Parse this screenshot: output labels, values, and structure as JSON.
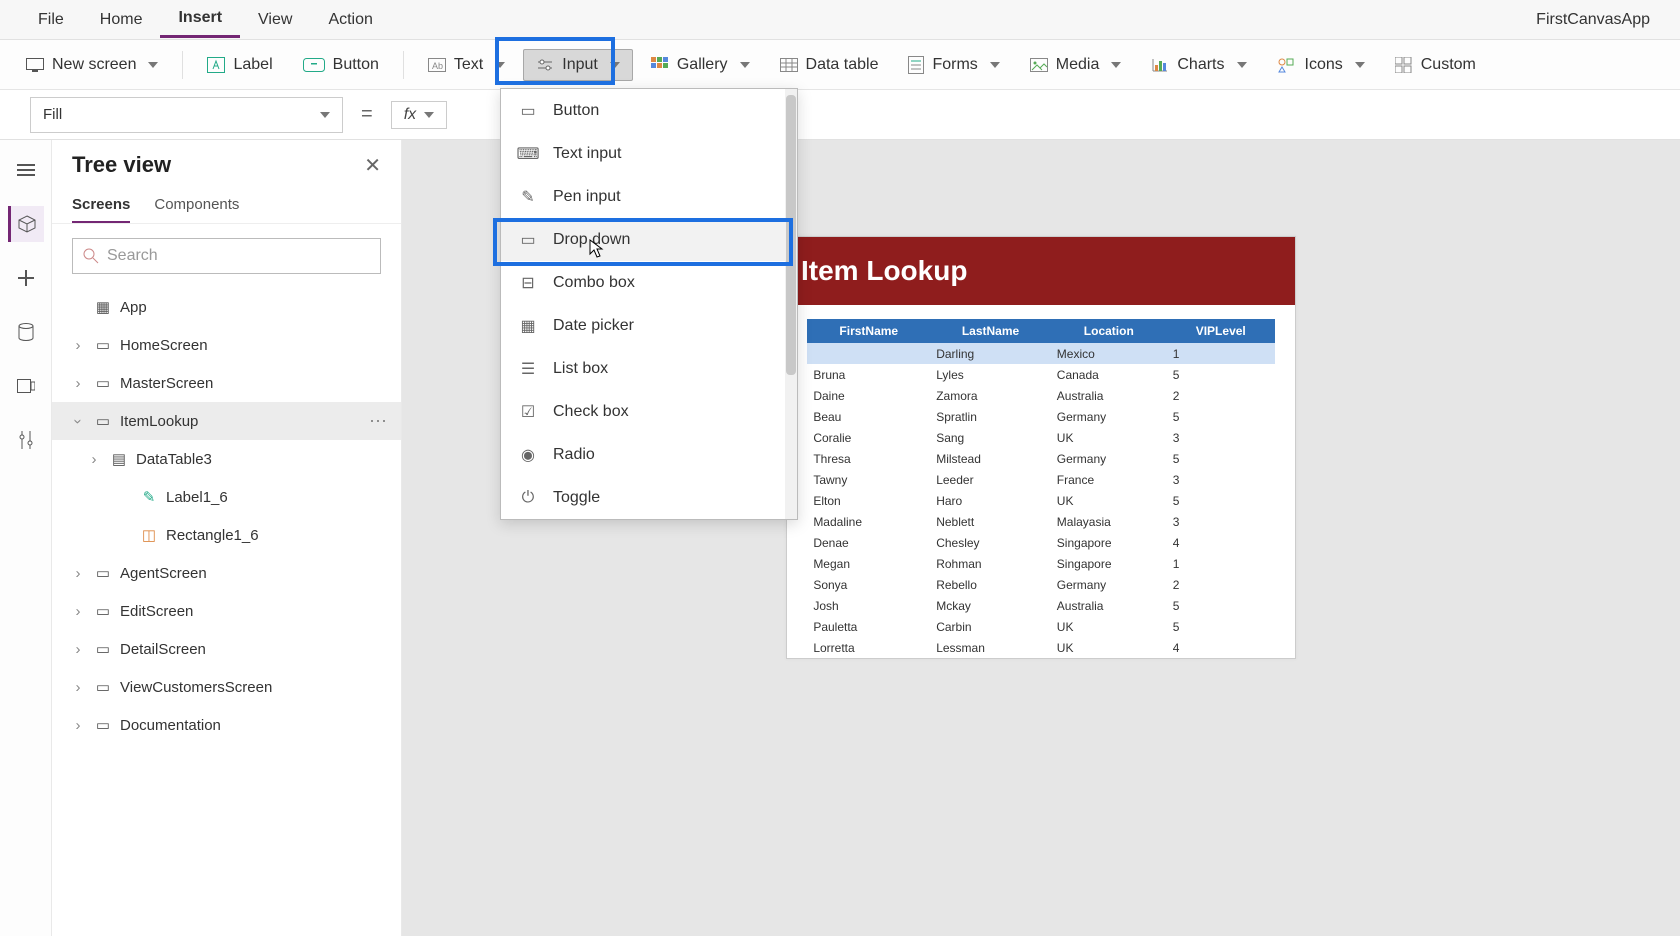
{
  "appName": "FirstCanvasApp",
  "menu": {
    "file": "File",
    "home": "Home",
    "insert": "Insert",
    "view": "View",
    "action": "Action"
  },
  "ribbon": {
    "newScreen": "New screen",
    "label": "Label",
    "button": "Button",
    "text": "Text",
    "input": "Input",
    "gallery": "Gallery",
    "dataTable": "Data table",
    "forms": "Forms",
    "media": "Media",
    "charts": "Charts",
    "icons": "Icons",
    "custom": "Custom"
  },
  "formula": {
    "property": "Fill",
    "equals": "=",
    "fx": "fx",
    "value": ""
  },
  "tree": {
    "title": "Tree view",
    "tabs": {
      "screens": "Screens",
      "components": "Components"
    },
    "searchPlaceholder": "Search",
    "app": "App",
    "screens": {
      "home": "HomeScreen",
      "master": "MasterScreen",
      "itemLookup": "ItemLookup",
      "dataTable": "DataTable3",
      "label": "Label1_6",
      "rectangle": "Rectangle1_6",
      "agent": "AgentScreen",
      "edit": "EditScreen",
      "detail": "DetailScreen",
      "viewCust": "ViewCustomersScreen",
      "doc": "Documentation"
    }
  },
  "inputMenu": {
    "button": "Button",
    "textInput": "Text input",
    "penInput": "Pen input",
    "dropDown": "Drop down",
    "comboBox": "Combo box",
    "datePicker": "Date picker",
    "listBox": "List box",
    "checkBox": "Check box",
    "radio": "Radio",
    "toggle": "Toggle"
  },
  "preview": {
    "title": "Item Lookup",
    "headers": [
      "FirstName",
      "LastName",
      "Location",
      "VIPLevel"
    ],
    "rows": [
      [
        "",
        "Darling",
        "Mexico",
        "1"
      ],
      [
        "Bruna",
        "Lyles",
        "Canada",
        "5"
      ],
      [
        "Daine",
        "Zamora",
        "Australia",
        "2"
      ],
      [
        "Beau",
        "Spratlin",
        "Germany",
        "5"
      ],
      [
        "Coralie",
        "Sang",
        "UK",
        "3"
      ],
      [
        "Thresa",
        "Milstead",
        "Germany",
        "5"
      ],
      [
        "Tawny",
        "Leeder",
        "France",
        "3"
      ],
      [
        "Elton",
        "Haro",
        "UK",
        "5"
      ],
      [
        "Madaline",
        "Neblett",
        "Malayasia",
        "3"
      ],
      [
        "Denae",
        "Chesley",
        "Singapore",
        "4"
      ],
      [
        "Megan",
        "Rohman",
        "Singapore",
        "1"
      ],
      [
        "Sonya",
        "Rebello",
        "Germany",
        "2"
      ],
      [
        "Josh",
        "Mckay",
        "Australia",
        "5"
      ],
      [
        "Pauletta",
        "Carbin",
        "UK",
        "5"
      ],
      [
        "Lorretta",
        "Lessman",
        "UK",
        "4"
      ]
    ]
  }
}
